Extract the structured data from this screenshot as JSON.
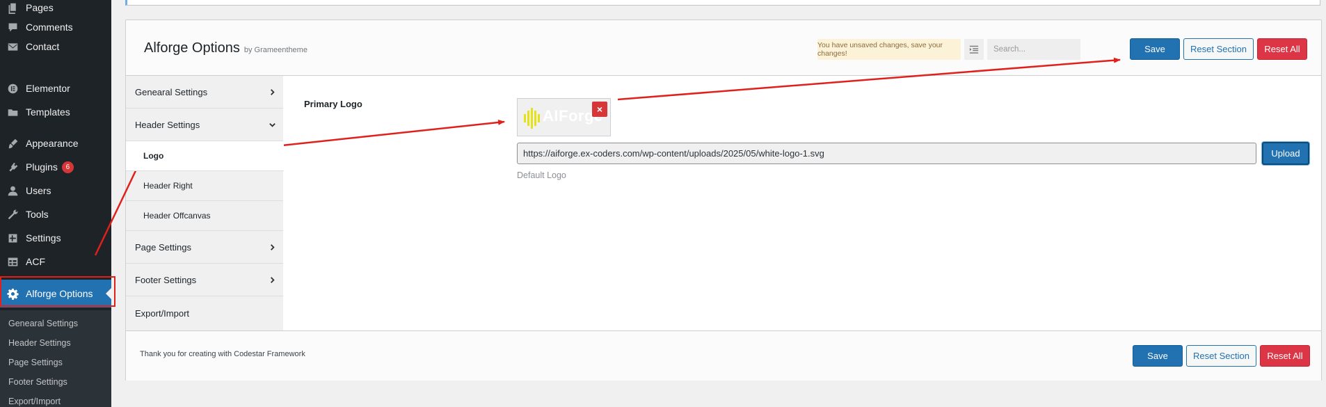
{
  "sidebar": {
    "items": [
      {
        "label": "Pages",
        "icon": "pages-icon"
      },
      {
        "label": "Comments",
        "icon": "comments-icon"
      },
      {
        "label": "Contact",
        "icon": "envelope-icon"
      },
      {
        "label": "Elementor",
        "icon": "elementor-icon"
      },
      {
        "label": "Templates",
        "icon": "folder-icon"
      },
      {
        "label": "Appearance",
        "icon": "brush-icon"
      },
      {
        "label": "Plugins",
        "icon": "plugin-icon",
        "badge": "6"
      },
      {
        "label": "Users",
        "icon": "user-icon"
      },
      {
        "label": "Tools",
        "icon": "wrench-icon"
      },
      {
        "label": "Settings",
        "icon": "settings-icon"
      },
      {
        "label": "ACF",
        "icon": "table-icon"
      }
    ],
    "current": {
      "label": "Alforge Options",
      "icon": "gear-icon"
    },
    "submenu": [
      "Genearal Settings",
      "Header Settings",
      "Page Settings",
      "Footer Settings",
      "Export/Import"
    ]
  },
  "panel": {
    "title": "Alforge Options",
    "subtitle": "by Grameentheme",
    "unsaved_notice": "You have unsaved changes, save your changes!",
    "search_placeholder": "Search...",
    "save_label": "Save",
    "reset_section_label": "Reset Section",
    "reset_all_label": "Reset All",
    "footer_text": "Thank you for creating with Codestar Framework"
  },
  "nav": {
    "general": "Genearal Settings",
    "header": "Header Settings",
    "header_sub": [
      "Logo",
      "Header Right",
      "Header Offcanvas"
    ],
    "page": "Page Settings",
    "footer": "Footer Settings",
    "export": "Export/Import"
  },
  "field": {
    "label": "Primary Logo",
    "logo_preview_text": "AIForge",
    "remove_icon": "×",
    "url_value": "https://aiforge.ex-coders.com/wp-content/uploads/2025/05/white-logo-1.svg",
    "upload_label": "Upload",
    "description": "Default Logo"
  },
  "colors": {
    "accent": "#2271b1",
    "danger": "#dc3545",
    "annotation": "#e0211b",
    "sidebar_bg": "#1d2327",
    "notice_bg": "#fcf2d8",
    "logo_yellow": "#e6e21a"
  }
}
